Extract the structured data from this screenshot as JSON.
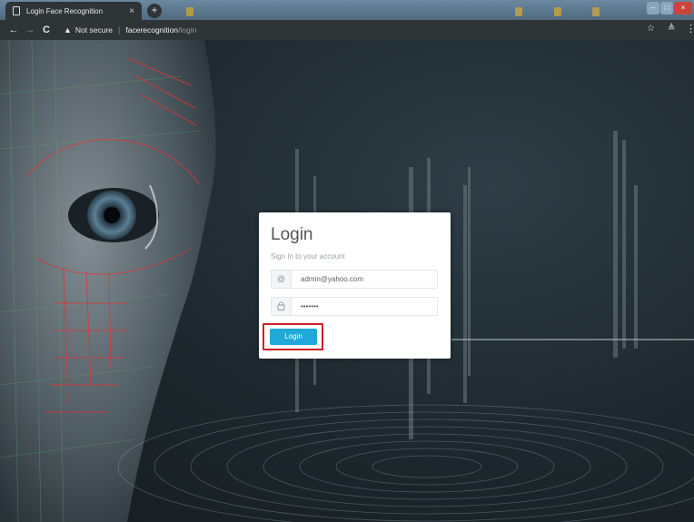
{
  "browser": {
    "tab_title": "Login Face Recognition",
    "tab_close": "×",
    "new_tab": "+",
    "not_secure": "Not secure",
    "url_separator": "|",
    "url_host": "facerecognition",
    "url_path": "/login",
    "icons": {
      "back": "back-arrow-icon",
      "forward": "forward-arrow-icon",
      "reload": "reload-icon",
      "warning": "warning-icon",
      "bookmark": "star-icon",
      "extension": "extension-icon",
      "menu": "menu-dots-icon"
    }
  },
  "login": {
    "title": "Login",
    "subtitle": "Sign In to your account",
    "email_addon": "@",
    "email_value": "admin@yahoo.com",
    "password_value": "•••••••",
    "submit_label": "Login"
  },
  "colors": {
    "primary_button": "#20a8d8",
    "highlight_border": "#d0202a",
    "card_background": "#ffffff"
  }
}
